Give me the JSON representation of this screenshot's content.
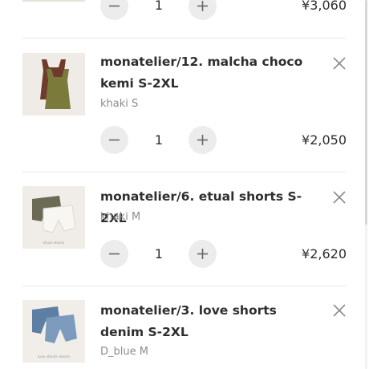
{
  "cart": {
    "partial_item": {
      "quantity": "1",
      "price": "¥3,060"
    },
    "items": [
      {
        "title": "monatelier/12. malcha choco kemi S-2XL",
        "variant": "khaki S",
        "quantity": "1",
        "price": "¥2,050",
        "thumb_label": ""
      },
      {
        "title": "monatelier/6. etual shorts S-2XL",
        "variant": "khaki M",
        "quantity": "1",
        "price": "¥2,620",
        "thumb_label": "etual shorts"
      },
      {
        "title": "monatelier/3. love shorts denim S-2XL",
        "variant": "D_blue M",
        "quantity": "1",
        "price": "",
        "thumb_label": "love shorts denim"
      }
    ]
  },
  "icons": {
    "remove": "close-icon",
    "decrease": "minus-icon",
    "increase": "plus-icon"
  },
  "colors": {
    "text": "#2e2e2e",
    "muted": "#8c8c8c",
    "button_bg": "#ececec",
    "divider": "#e8e8e8"
  }
}
